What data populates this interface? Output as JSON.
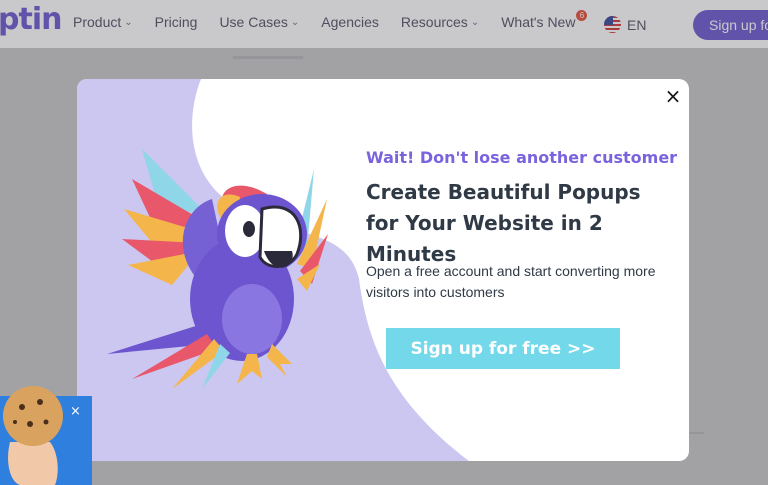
{
  "header": {
    "logo_text": "ptin",
    "nav": [
      {
        "label": "Product",
        "has_chevron": true
      },
      {
        "label": "Pricing",
        "has_chevron": false
      },
      {
        "label": "Use Cases",
        "has_chevron": true
      },
      {
        "label": "Agencies",
        "has_chevron": false
      },
      {
        "label": "Resources",
        "has_chevron": true
      },
      {
        "label": "What's New",
        "has_chevron": false,
        "badge": "6"
      }
    ],
    "language": "EN",
    "signup_label": "Sign up fo"
  },
  "modal": {
    "close_icon": "close-icon",
    "eyebrow": "Wait! Don't lose another customer",
    "headline": "Create Beautiful Popups for Your Website in 2 Minutes",
    "subtext": "Open a free account and start converting more visitors into customers",
    "cta_label": "Sign up for free >>"
  },
  "cookie_widget": {
    "close_icon": "close-icon",
    "close_glyph": "×"
  },
  "colors": {
    "brand_purple": "#6f5bd1",
    "eyebrow_purple": "#7b63dd",
    "lavender": "#cbc7f0",
    "cta_cyan": "#73d8ea",
    "cookie_blue": "#2f7fde"
  }
}
